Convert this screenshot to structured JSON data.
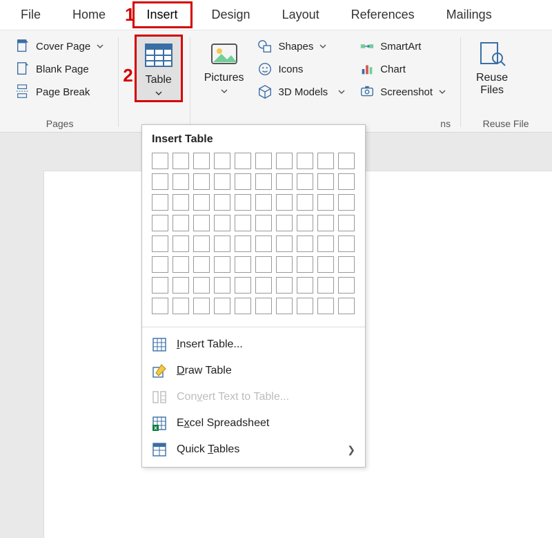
{
  "tabs": {
    "file": "File",
    "home": "Home",
    "insert": "Insert",
    "design": "Design",
    "layout": "Layout",
    "references": "References",
    "mailings": "Mailings"
  },
  "annotations": {
    "one": "1",
    "two": "2"
  },
  "pages_group": {
    "label": "Pages",
    "cover_page": "Cover Page",
    "blank_page": "Blank Page",
    "page_break": "Page Break"
  },
  "table_group": {
    "table": "Table"
  },
  "illustrations_group": {
    "pictures": "Pictures",
    "shapes": "Shapes",
    "icons": "Icons",
    "models3d": "3D Models",
    "smartart": "SmartArt",
    "chart": "Chart",
    "screenshot": "Screenshot",
    "ns_suffix": "ns"
  },
  "reuse_group": {
    "reuse": "Reuse",
    "files": "Files",
    "label": "Reuse File"
  },
  "dropdown": {
    "title": "Insert Table",
    "insert_table": "Insert Table...",
    "draw_table": "Draw Table",
    "convert": "Convert Text to Table...",
    "excel": "Excel Spreadsheet",
    "quick": "Quick Tables",
    "grid_cols": 10,
    "grid_rows": 8
  }
}
